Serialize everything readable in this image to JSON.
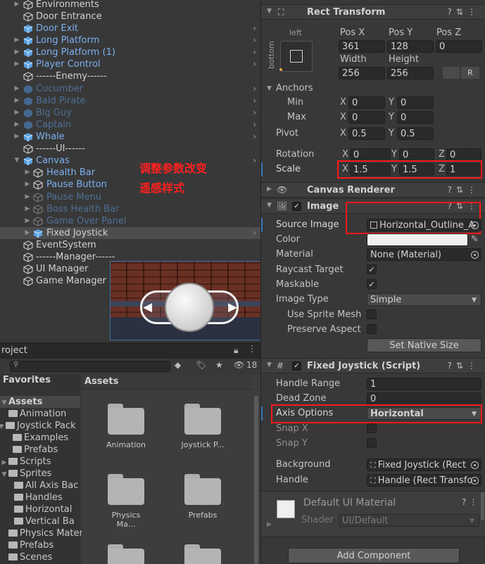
{
  "hierarchy": {
    "items": [
      {
        "label": "Environments",
        "top": 0
      },
      {
        "label": "Door Entrance"
      },
      {
        "label": "Door Exit"
      },
      {
        "label": "Long Platform"
      },
      {
        "label": "Long Platform (1)"
      },
      {
        "label": "Player Control"
      },
      {
        "label": "------Enemy------"
      },
      {
        "label": "Cucumber"
      },
      {
        "label": "Bald Pirate"
      },
      {
        "label": "Big Guy"
      },
      {
        "label": "Captain"
      },
      {
        "label": "Whale"
      },
      {
        "label": "------UI------"
      },
      {
        "label": "Canvas"
      },
      {
        "label": "Health Bar"
      },
      {
        "label": "Pause Button"
      },
      {
        "label": "Pause Menu"
      },
      {
        "label": "Boss Health Bar"
      },
      {
        "label": "Game Over Panel"
      },
      {
        "label": "Fixed Joystick"
      },
      {
        "label": "EventSystem"
      },
      {
        "label": "------Manager------"
      },
      {
        "label": "UI Manager"
      },
      {
        "label": "Game Manager"
      }
    ],
    "annotation_line1": "调整参数改变",
    "annotation_line2": "遥感样式"
  },
  "project": {
    "tab_label": "roject",
    "hidden_count": "18",
    "favorites_label": "Favorites",
    "assets_header": "Assets",
    "tree": [
      {
        "label": "Assets"
      },
      {
        "label": "Animation"
      },
      {
        "label": "Joystick Pack"
      },
      {
        "label": "Examples"
      },
      {
        "label": "Prefabs"
      },
      {
        "label": "Scripts"
      },
      {
        "label": "Sprites"
      },
      {
        "label": "All Axis Bac"
      },
      {
        "label": "Handles"
      },
      {
        "label": "Horizontal"
      },
      {
        "label": "Vertical Ba"
      },
      {
        "label": "Physics Materia"
      },
      {
        "label": "Prefabs"
      },
      {
        "label": "Scenes"
      }
    ],
    "tiles": [
      {
        "label": "Animation"
      },
      {
        "label": "Joystick P..."
      },
      {
        "label": "Physics Ma..."
      },
      {
        "label": "Prefabs"
      }
    ]
  },
  "inspector": {
    "rect_transform": {
      "title": "Rect Transform",
      "anchor_preset_left": "left",
      "anchor_preset_bottom": "bottom",
      "pos_x_label": "Pos X",
      "pos_y_label": "Pos Y",
      "pos_z_label": "Pos Z",
      "pos_x": "361",
      "pos_y": "128",
      "pos_z": "0",
      "width_label": "Width",
      "height_label": "Height",
      "width": "256",
      "height": "256",
      "anchors_label": "Anchors",
      "min_label": "Min",
      "max_label": "Max",
      "min_x": "0",
      "min_y": "0",
      "max_x": "0",
      "max_y": "0",
      "pivot_label": "Pivot",
      "pivot_x": "0.5",
      "pivot_y": "0.5",
      "rotation_label": "Rotation",
      "rot_x": "0",
      "rot_y": "0",
      "rot_z": "0",
      "scale_label": "Scale",
      "scale_x": "1.5",
      "scale_y": "1.5",
      "scale_z": "1",
      "x": "X",
      "y": "Y",
      "z": "Z",
      "r": "R"
    },
    "canvas_renderer": {
      "title": "Canvas Renderer"
    },
    "image": {
      "title": "Image",
      "source_image_label": "Source Image",
      "source_image": "Horizontal_Outline_A",
      "color_label": "Color",
      "material_label": "Material",
      "material": "None (Material)",
      "raycast_label": "Raycast Target",
      "maskable_label": "Maskable",
      "image_type_label": "Image Type",
      "image_type": "Simple",
      "use_sprite_mesh_label": "Use Sprite Mesh",
      "preserve_aspect_label": "Preserve Aspect",
      "set_native_size": "Set Native Size"
    },
    "fixed_joystick": {
      "title": "Fixed Joystick (Script)",
      "handle_range_label": "Handle Range",
      "handle_range": "1",
      "dead_zone_label": "Dead Zone",
      "dead_zone": "0",
      "axis_options_label": "Axis Options",
      "axis_options": "Horizontal",
      "snap_x_label": "Snap X",
      "snap_y_label": "Snap Y",
      "background_label": "Background",
      "background": "Fixed Joystick (Rect",
      "handle_label": "Handle",
      "handle": "Handle (Rect Transfo"
    },
    "material": {
      "title": "Default UI Material",
      "shader_label": "Shader",
      "shader": "UI/Default"
    },
    "add_component": "Add Component"
  },
  "colors": {
    "annotation_red": "#ff1818",
    "link_blue": "#7cb0f0",
    "panel_bg": "#383838"
  }
}
